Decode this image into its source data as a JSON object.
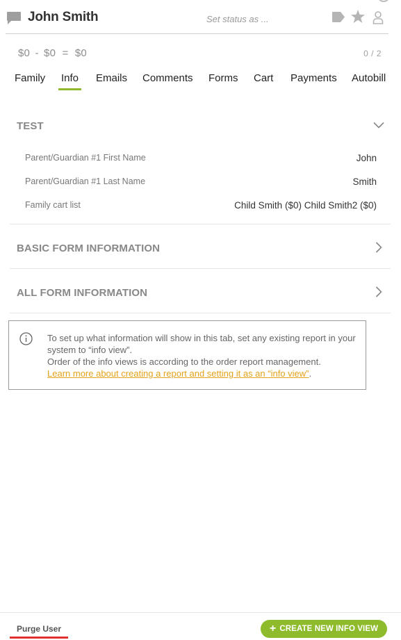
{
  "header": {
    "user_name": "John Smith",
    "status_placeholder": "Set status as ..."
  },
  "balance": {
    "a": "$0",
    "minus": "-",
    "b": "$0",
    "equals": "=",
    "c": "$0",
    "count": "0 / 2"
  },
  "tabs": [
    {
      "label": "Family"
    },
    {
      "label": "Info",
      "active": true
    },
    {
      "label": "Emails"
    },
    {
      "label": "Comments"
    },
    {
      "label": "Forms"
    },
    {
      "label": "Cart"
    },
    {
      "label": "Payments"
    },
    {
      "label": "Autobill"
    }
  ],
  "sections": {
    "test": {
      "title": "TEST",
      "fields": [
        {
          "label": "Parent/Guardian #1 First Name",
          "value": "John"
        },
        {
          "label": "Parent/Guardian #1 Last Name",
          "value": "Smith"
        },
        {
          "label": "Family cart list",
          "value": "Child Smith ($0) Child Smith2 ($0)"
        }
      ]
    },
    "basic": {
      "title": "BASIC FORM INFORMATION"
    },
    "all": {
      "title": "ALL FORM INFORMATION"
    }
  },
  "info_box": {
    "line1": "To set up what information will show in this tab, set any existing report in your system to “info view”.",
    "line2": "Order of the info views is according to the order report management.",
    "link": "Learn more about creating a report and setting it as an “info view”",
    "period": "."
  },
  "footer": {
    "purge_label": "Purge User",
    "create_label": "CREATE NEW INFO VIEW",
    "create_plus": "+"
  },
  "colors": {
    "accent_green": "#8dbb2c",
    "link_orange": "#e3a21a",
    "purge_red": "#e03030"
  }
}
